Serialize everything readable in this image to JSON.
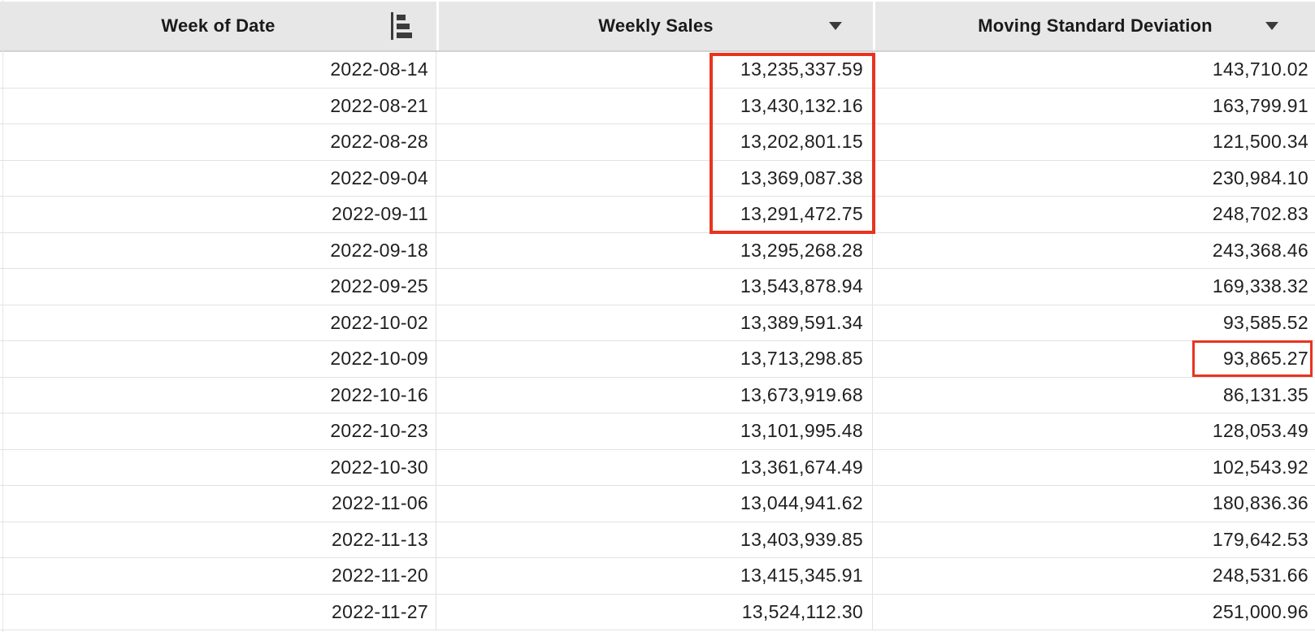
{
  "header": {
    "columns": [
      {
        "label": "Week of Date",
        "control": "sort-ascending-icon"
      },
      {
        "label": "Weekly Sales",
        "control": "dropdown-arrow-icon"
      },
      {
        "label": "Moving Standard Deviation",
        "control": "dropdown-arrow-icon"
      }
    ]
  },
  "table": {
    "column_keys": [
      "week_of_date",
      "weekly_sales",
      "moving_standard_deviation"
    ],
    "rows": [
      [
        "2022-08-14",
        "13,235,337.59",
        "143,710.02"
      ],
      [
        "2022-08-21",
        "13,430,132.16",
        "163,799.91"
      ],
      [
        "2022-08-28",
        "13,202,801.15",
        "121,500.34"
      ],
      [
        "2022-09-04",
        "13,369,087.38",
        "230,984.10"
      ],
      [
        "2022-09-11",
        "13,291,472.75",
        "248,702.83"
      ],
      [
        "2022-09-18",
        "13,295,268.28",
        "243,368.46"
      ],
      [
        "2022-09-25",
        "13,543,878.94",
        "169,338.32"
      ],
      [
        "2022-10-02",
        "13,389,591.34",
        "93,585.52"
      ],
      [
        "2022-10-09",
        "13,713,298.85",
        "93,865.27"
      ],
      [
        "2022-10-16",
        "13,673,919.68",
        "86,131.35"
      ],
      [
        "2022-10-23",
        "13,101,995.48",
        "128,053.49"
      ],
      [
        "2022-10-30",
        "13,361,674.49",
        "102,543.92"
      ],
      [
        "2022-11-06",
        "13,044,941.62",
        "180,836.36"
      ],
      [
        "2022-11-13",
        "13,403,939.85",
        "179,642.53"
      ],
      [
        "2022-11-20",
        "13,415,345.91",
        "248,531.66"
      ],
      [
        "2022-11-27",
        "13,524,112.30",
        "251,000.96"
      ]
    ]
  },
  "highlights": {
    "color": "#e8341f",
    "weekly_sales_box": {
      "column": "Weekly Sales",
      "first_row_date": "2022-08-14",
      "last_row_date": "2022-09-11",
      "values": [
        "13,235,337.59",
        "13,430,132.16",
        "13,202,801.15",
        "13,369,087.38",
        "13,291,472.75"
      ]
    },
    "std_dev_box": {
      "column": "Moving Standard Deviation",
      "row_date": "2022-10-09",
      "value": "93,865.27"
    }
  },
  "colors": {
    "header_bg": "#e7e7e7",
    "row_divider": "#e2e2e2",
    "text": "#1f1f1f",
    "highlight": "#e8341f"
  }
}
